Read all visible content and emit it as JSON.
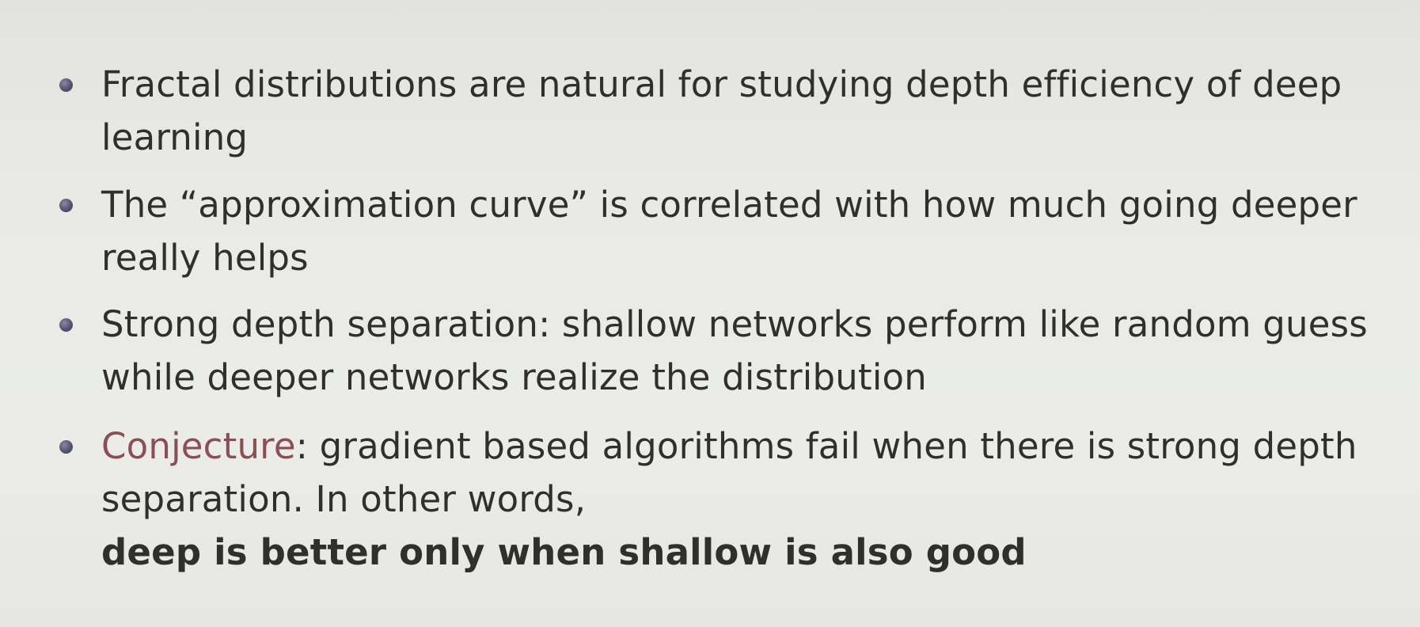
{
  "slide": {
    "bullets": [
      {
        "lines": [
          "Fractal distributions are natural for studying depth efficiency of deep",
          "learning"
        ]
      },
      {
        "lines": [
          "The “approximation curve” is correlated with how much going deeper",
          "really helps"
        ]
      },
      {
        "lines": [
          "Strong depth separation: shallow networks perform like random guess",
          "while deeper networks realize the distribution"
        ]
      },
      {
        "accent_word": "Conjecture",
        "line1_rest": ": gradient based algorithms fail when there is strong depth",
        "line2": "separation. In other words,",
        "bold_line": "deep is better only when shallow is also good"
      }
    ],
    "colors": {
      "background": "#e9eae6",
      "text": "#2f302e",
      "accent": "#8a4f55",
      "bullet": "#55536f"
    }
  }
}
